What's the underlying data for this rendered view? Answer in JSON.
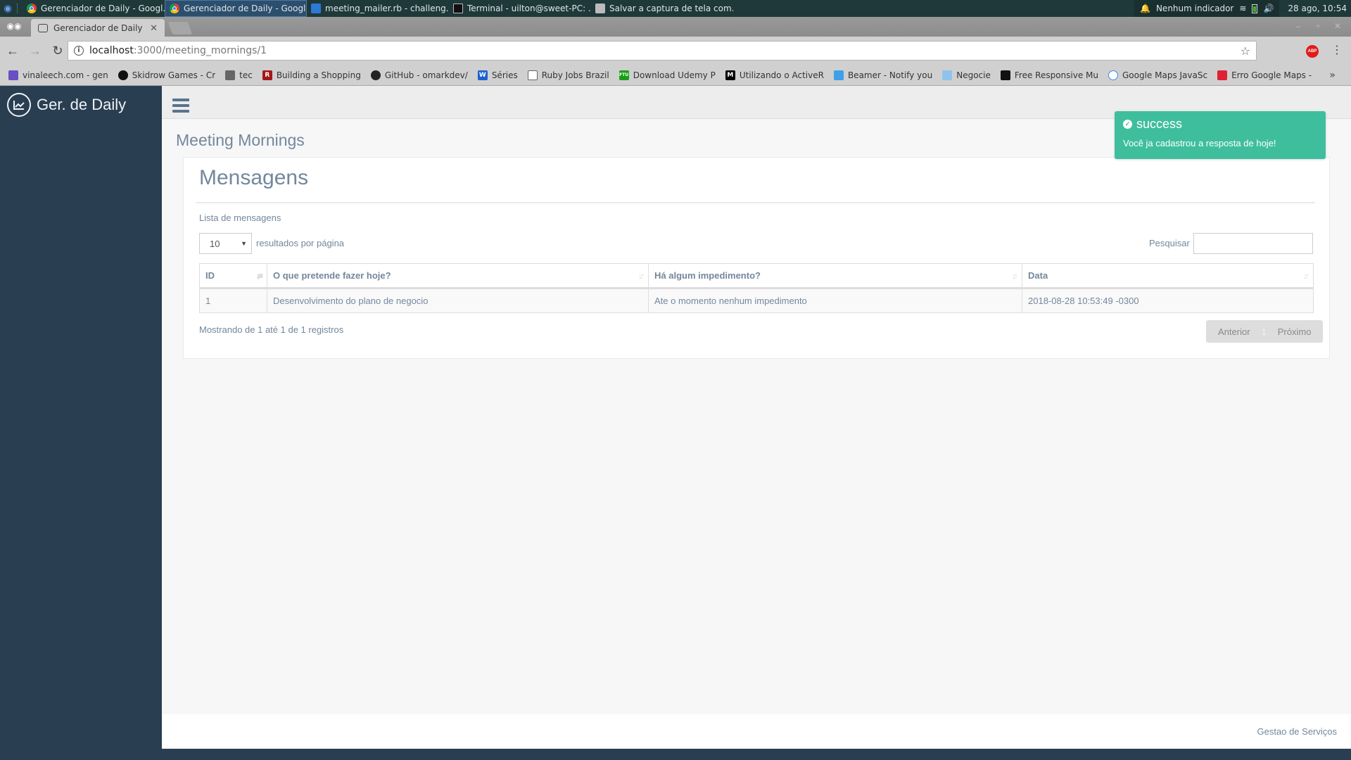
{
  "taskbar": {
    "tasks": [
      {
        "label": "Gerenciador de Daily - Googl...",
        "icon": "chrome-icon",
        "active": false
      },
      {
        "label": "Gerenciador de Daily - Googl...",
        "icon": "chrome-icon",
        "active": true
      },
      {
        "label": "meeting_mailer.rb - challeng...",
        "icon": "vscode-icon",
        "active": false
      },
      {
        "label": "Terminal - uilton@sweet-PC: ...",
        "icon": "terminal-icon",
        "active": false
      },
      {
        "label": "Salvar a captura de tela com...",
        "icon": "screenshot-icon",
        "active": false
      }
    ],
    "notification_label": "Nenhum indicador",
    "clock": "28 ago, 10:54"
  },
  "browser": {
    "tab_title": "Gerenciador de Daily",
    "url_host": "localhost",
    "url_path": ":3000/meeting_mornings/1",
    "extension_label": "ABP",
    "bookmarks": [
      {
        "label": "vinaleech.com - gen",
        "icon": "vinaleech-icon",
        "color": "#6a4fc4"
      },
      {
        "label": "Skidrow Games - Cr",
        "icon": "skidrow-icon",
        "color": "#111111"
      },
      {
        "label": "tec",
        "icon": "folder-icon",
        "color": "#666666"
      },
      {
        "label": "Building a Shopping",
        "icon": "r-icon",
        "color": "#a4161a"
      },
      {
        "label": "GitHub - omarkdev/",
        "icon": "github-icon",
        "color": "#222222"
      },
      {
        "label": "Séries",
        "icon": "w-icon",
        "color": "#1d5fd1"
      },
      {
        "label": "Ruby Jobs Brazil",
        "icon": "page-icon",
        "color": "#ffffff"
      },
      {
        "label": "Download Udemy P",
        "icon": "ftu-icon",
        "color": "#1a9e1a"
      },
      {
        "label": "Utilizando o ActiveR",
        "icon": "medium-icon",
        "color": "#000000"
      },
      {
        "label": "Beamer - Notify you",
        "icon": "beamer-icon",
        "color": "#3ea0e8"
      },
      {
        "label": "Negocie",
        "icon": "handshake-icon",
        "color": "#8fc3ee"
      },
      {
        "label": "Free Responsive Mu",
        "icon": "horse-icon",
        "color": "#111111"
      },
      {
        "label": "Google Maps JavaSc",
        "icon": "google-dev-icon",
        "color": "#ffffff"
      },
      {
        "label": "Erro Google Maps -",
        "icon": "flag-icon",
        "color": "#d23"
      }
    ],
    "more_label": "»"
  },
  "app": {
    "brand": "Ger. de Daily",
    "page_title": "Meeting Mornings",
    "panel_title": "Mensagens",
    "panel_subtitle": "Lista de mensagens",
    "length_value": "10",
    "length_label": "resultados por página",
    "search_label": "Pesquisar",
    "search_value": "",
    "table": {
      "columns": [
        "ID",
        "O que pretende fazer hoje?",
        "Há algum impedimento?",
        "Data"
      ],
      "rows": [
        [
          "1",
          "Desenvolvimento do plano de negocio",
          "Ate o momento nenhum impedimento",
          "2018-08-28 10:53:49 -0300"
        ]
      ]
    },
    "info": "Mostrando de 1 até 1 de 1 registros",
    "pagination": {
      "prev": "Anterior",
      "current": "1",
      "next": "Próximo"
    },
    "footer": "Gestao de Serviços",
    "toast": {
      "title": "success",
      "message": "Você ja cadastrou a resposta de hoje!",
      "color": "#3fbe9e"
    }
  }
}
